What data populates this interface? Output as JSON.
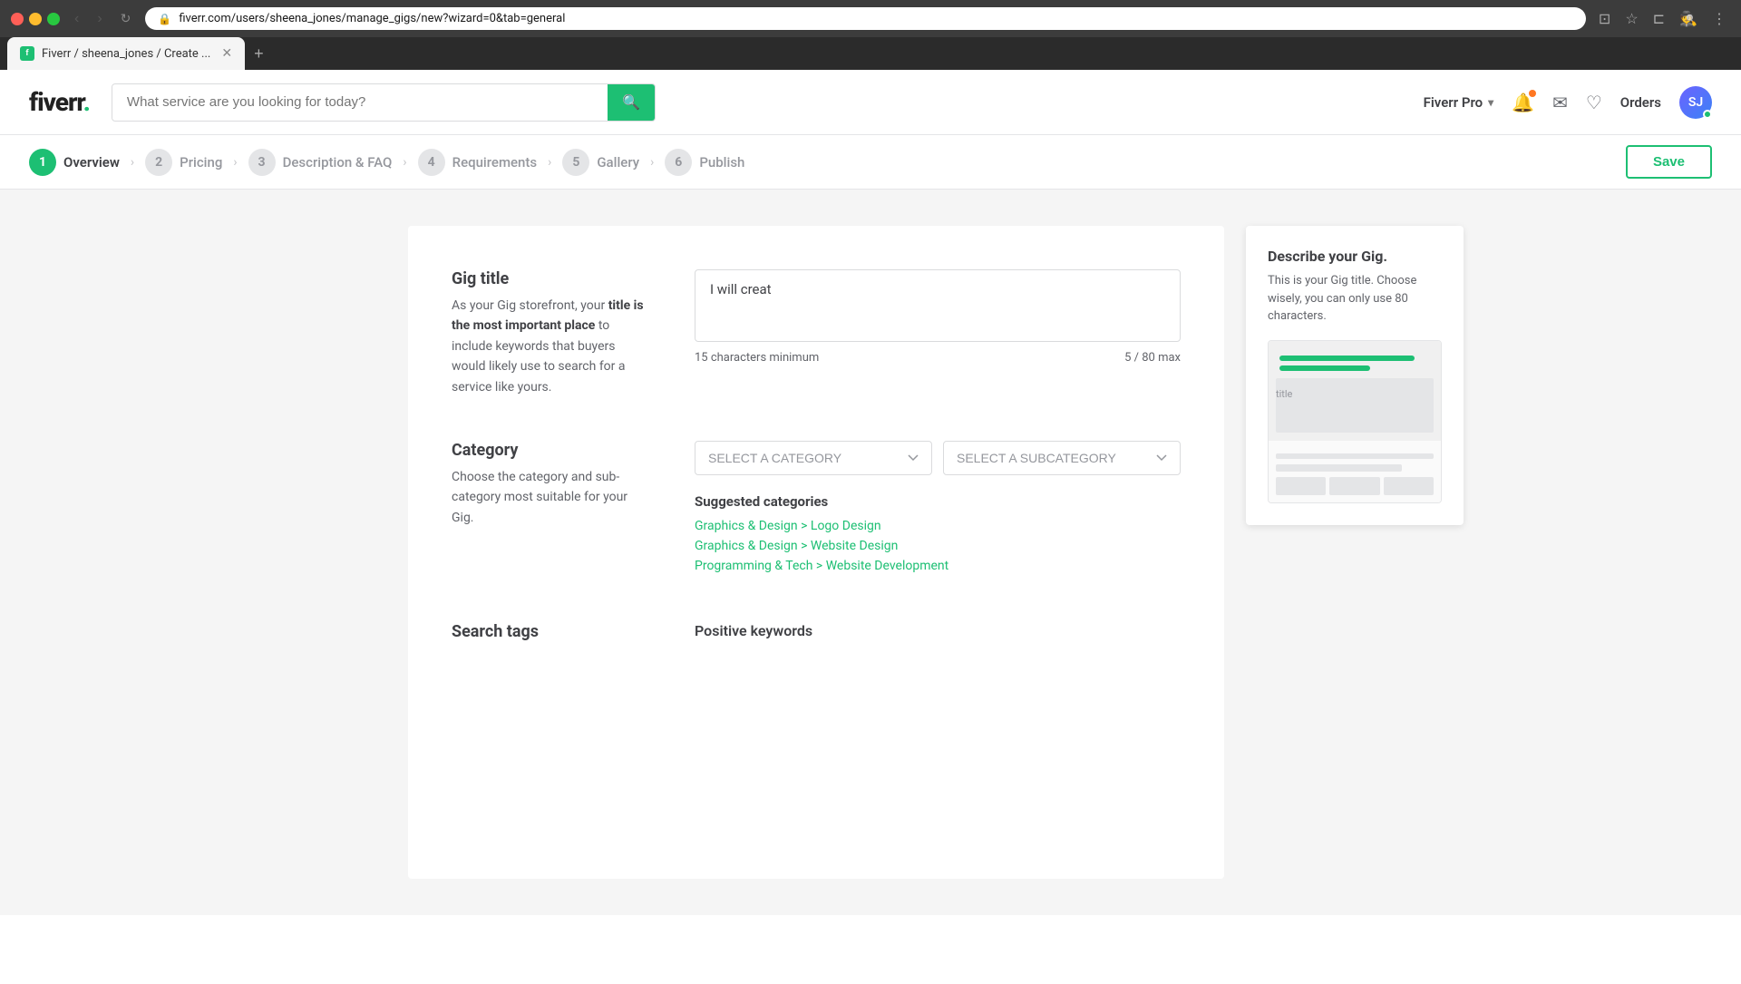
{
  "browser": {
    "url": "fiverr.com/users/sheena_jones/manage_gigs/new?wizard=0&tab=general",
    "tab_title": "Fiverr / sheena_jones / Create ...",
    "favicon_text": "f"
  },
  "header": {
    "logo": "fiverr",
    "logo_dot": ".",
    "search_placeholder": "What service are you looking for today?",
    "fiverr_pro": "Fiverr Pro",
    "orders": "Orders"
  },
  "wizard": {
    "save_label": "Save",
    "steps": [
      {
        "number": "1",
        "label": "Overview",
        "state": "active"
      },
      {
        "number": "2",
        "label": "Pricing",
        "state": "inactive"
      },
      {
        "number": "3",
        "label": "Description & FAQ",
        "state": "inactive"
      },
      {
        "number": "4",
        "label": "Requirements",
        "state": "inactive"
      },
      {
        "number": "5",
        "label": "Gallery",
        "state": "inactive"
      },
      {
        "number": "6",
        "label": "Publish",
        "state": "inactive"
      }
    ]
  },
  "gig_title": {
    "section_title": "Gig title",
    "description_1": "As your Gig storefront, your",
    "description_bold": "title is the most important place",
    "description_2": " to include keywords that buyers would likely use to search for a service like yours.",
    "input_value": "I will creat",
    "min_label": "15 characters minimum",
    "count_label": "5 / 80 max"
  },
  "category": {
    "section_title": "Category",
    "description": "Choose the category and sub-category most suitable for your Gig.",
    "select_category_label": "SELECT A CATEGORY",
    "select_subcategory_label": "SELECT A SUBCATEGORY",
    "suggested_title": "Suggested categories",
    "suggestions": [
      "Graphics & Design > Logo Design",
      "Graphics & Design > Website Design",
      "Programming & Tech > Website Development"
    ]
  },
  "search_tags": {
    "section_title": "Search tags",
    "pos_keywords_title": "Positive keywords"
  },
  "preview_panel": {
    "title": "Describe your Gig.",
    "description": "This is your Gig title. Choose wisely, you can only use 80 characters."
  }
}
